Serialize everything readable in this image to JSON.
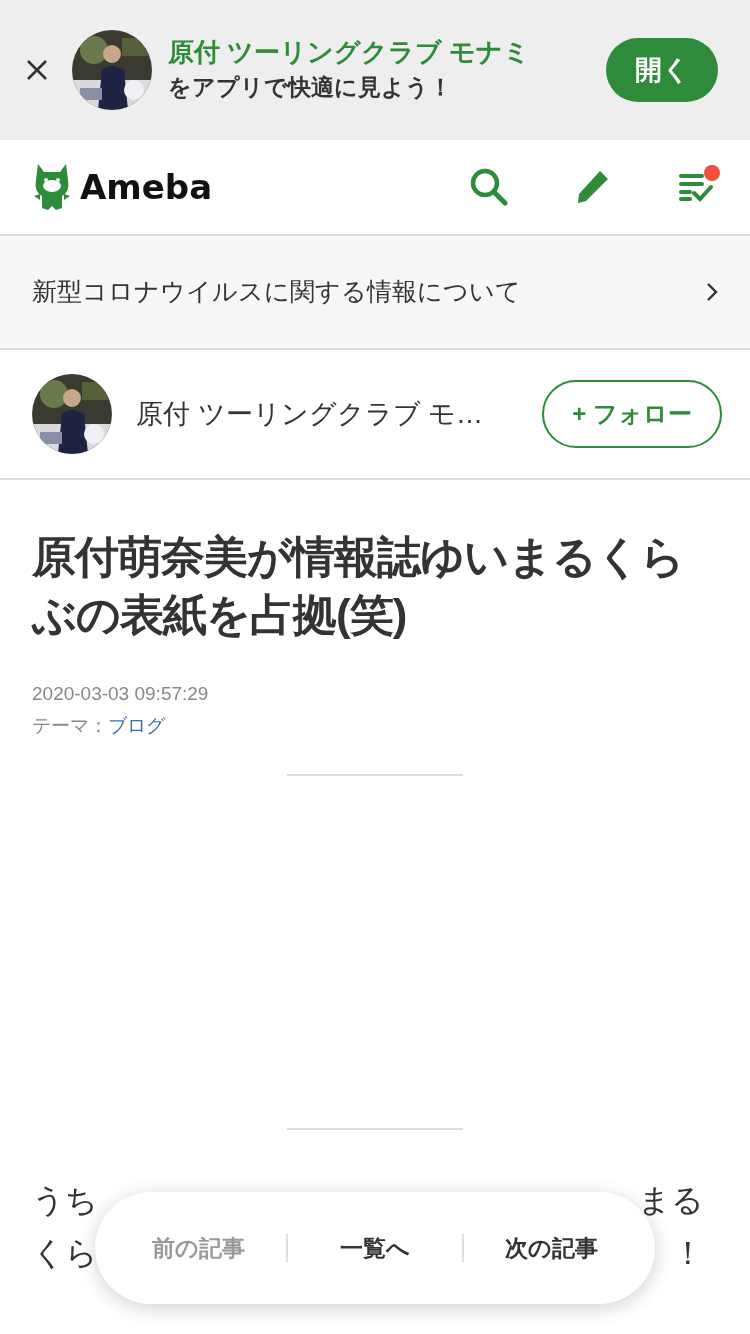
{
  "app_banner": {
    "title": "原付 ツーリングクラブ モナミ",
    "message": "をアプリで快適に見よう！",
    "open_button": "開く"
  },
  "header": {
    "logo": "Ameba",
    "notification": true
  },
  "notice": {
    "text": "新型コロナウイルスに関する情報について"
  },
  "author": {
    "name": "原付 ツーリングクラブ モ…",
    "follow_button": "+ フォロー"
  },
  "article": {
    "title": "原付萌奈美が情報誌ゆいまるくらぶの表紙を占拠(笑)",
    "date": "2020-03-03 09:57:29",
    "theme_label": "テーマ：",
    "theme": "ブログ",
    "body_lines": [
      {
        "start": "うち",
        "end": "まる"
      },
      {
        "start": "くら",
        "end": "！"
      }
    ]
  },
  "pager": [
    {
      "label": "前の記事",
      "disabled": true
    },
    {
      "label": "一覧へ",
      "disabled": false
    },
    {
      "label": "次の記事",
      "disabled": false
    }
  ]
}
